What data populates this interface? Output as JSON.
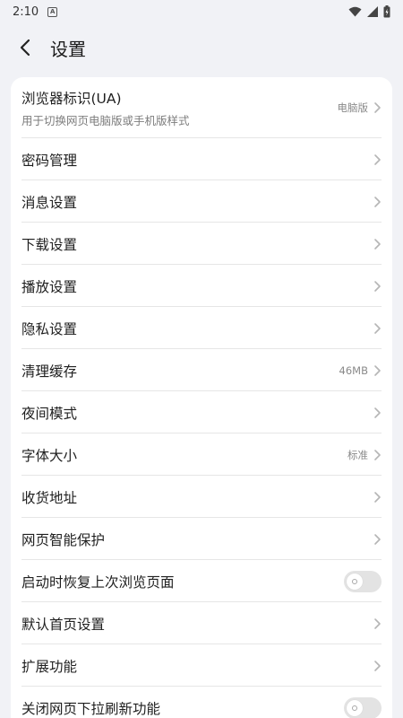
{
  "status_bar": {
    "time": "2:10",
    "notification_icon": "A"
  },
  "header": {
    "title": "设置"
  },
  "settings": [
    {
      "label": "浏览器标识(UA)",
      "sub": "用于切换网页电脑版或手机版样式",
      "value": "电脑版",
      "control": "chevron"
    },
    {
      "label": "密码管理",
      "control": "chevron"
    },
    {
      "label": "消息设置",
      "control": "chevron"
    },
    {
      "label": "下载设置",
      "control": "chevron"
    },
    {
      "label": "播放设置",
      "control": "chevron"
    },
    {
      "label": "隐私设置",
      "control": "chevron"
    },
    {
      "label": "清理缓存",
      "value": "46MB",
      "control": "chevron"
    },
    {
      "label": "夜间模式",
      "control": "chevron"
    },
    {
      "label": "字体大小",
      "value": "标准",
      "control": "chevron"
    },
    {
      "label": "收货地址",
      "control": "chevron"
    },
    {
      "label": "网页智能保护",
      "control": "chevron"
    },
    {
      "label": "启动时恢复上次浏览页面",
      "control": "toggle",
      "on": false
    },
    {
      "label": "默认首页设置",
      "control": "chevron"
    },
    {
      "label": "扩展功能",
      "control": "chevron"
    },
    {
      "label": "关闭网页下拉刷新功能",
      "control": "toggle",
      "on": false
    }
  ]
}
